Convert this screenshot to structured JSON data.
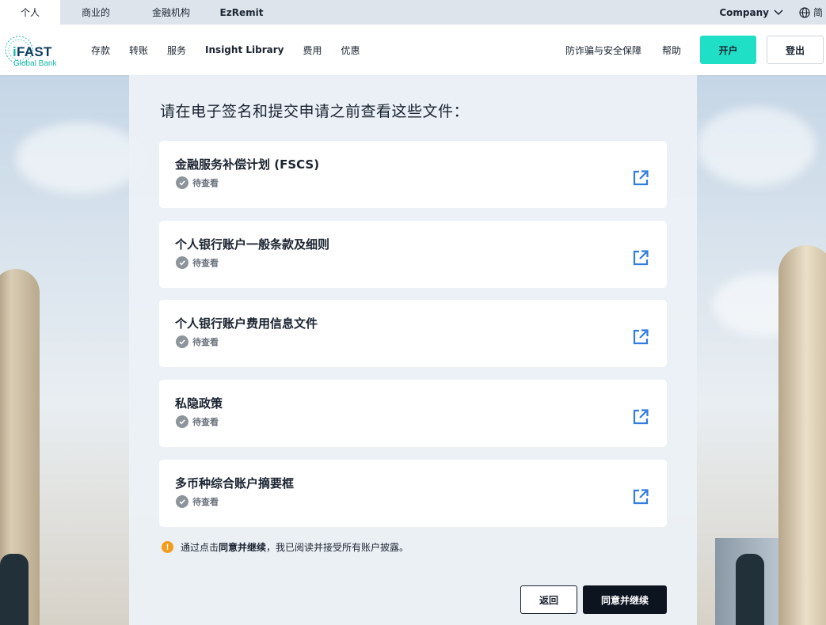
{
  "topbar": {
    "tabs": [
      {
        "label": "个人"
      },
      {
        "label": "商业的"
      },
      {
        "label": "金融机构"
      },
      {
        "label": "EzRemit"
      }
    ],
    "company_label": "Company",
    "language_label": "简"
  },
  "logo": {
    "name_i": "i",
    "name_rest": "FAST",
    "subtitle": "Global Bank"
  },
  "nav": {
    "links": [
      "存款",
      "转账",
      "服务",
      "Insight Library",
      "费用",
      "优惠"
    ],
    "right_links": [
      "防诈骗与安全保障",
      "帮助"
    ],
    "open_account_label": "开户",
    "logout_label": "登出"
  },
  "main": {
    "heading": "请在电子签名和提交申请之前查看这些文件：",
    "documents": [
      {
        "title": "金融服务补偿计划 (FSCS)",
        "status": "待查看"
      },
      {
        "title": "个人银行账户一般条款及细则",
        "status": "待查看"
      },
      {
        "title": "个人银行账户费用信息文件",
        "status": "待查看"
      },
      {
        "title": "私隐政策",
        "status": "待查看"
      },
      {
        "title": "多币种综合账户摘要框",
        "status": "待查看"
      }
    ],
    "notice": {
      "prefix": "通过点击",
      "bold": "同意并继续",
      "suffix": "，我已阅读并接受所有账户披露。",
      "icon_text": "!"
    },
    "back_label": "返回",
    "agree_label": "同意并继续"
  },
  "colors": {
    "accent_teal": "#1fe0c6",
    "link_blue": "#2f7de1",
    "warning": "#f39c1b",
    "dark_button": "#0c1420"
  },
  "icons": {
    "external_link": "external-link-icon",
    "check": "check-circle-icon",
    "globe": "globe-icon",
    "chevron": "chevron-down-icon",
    "warning": "warning-icon"
  }
}
